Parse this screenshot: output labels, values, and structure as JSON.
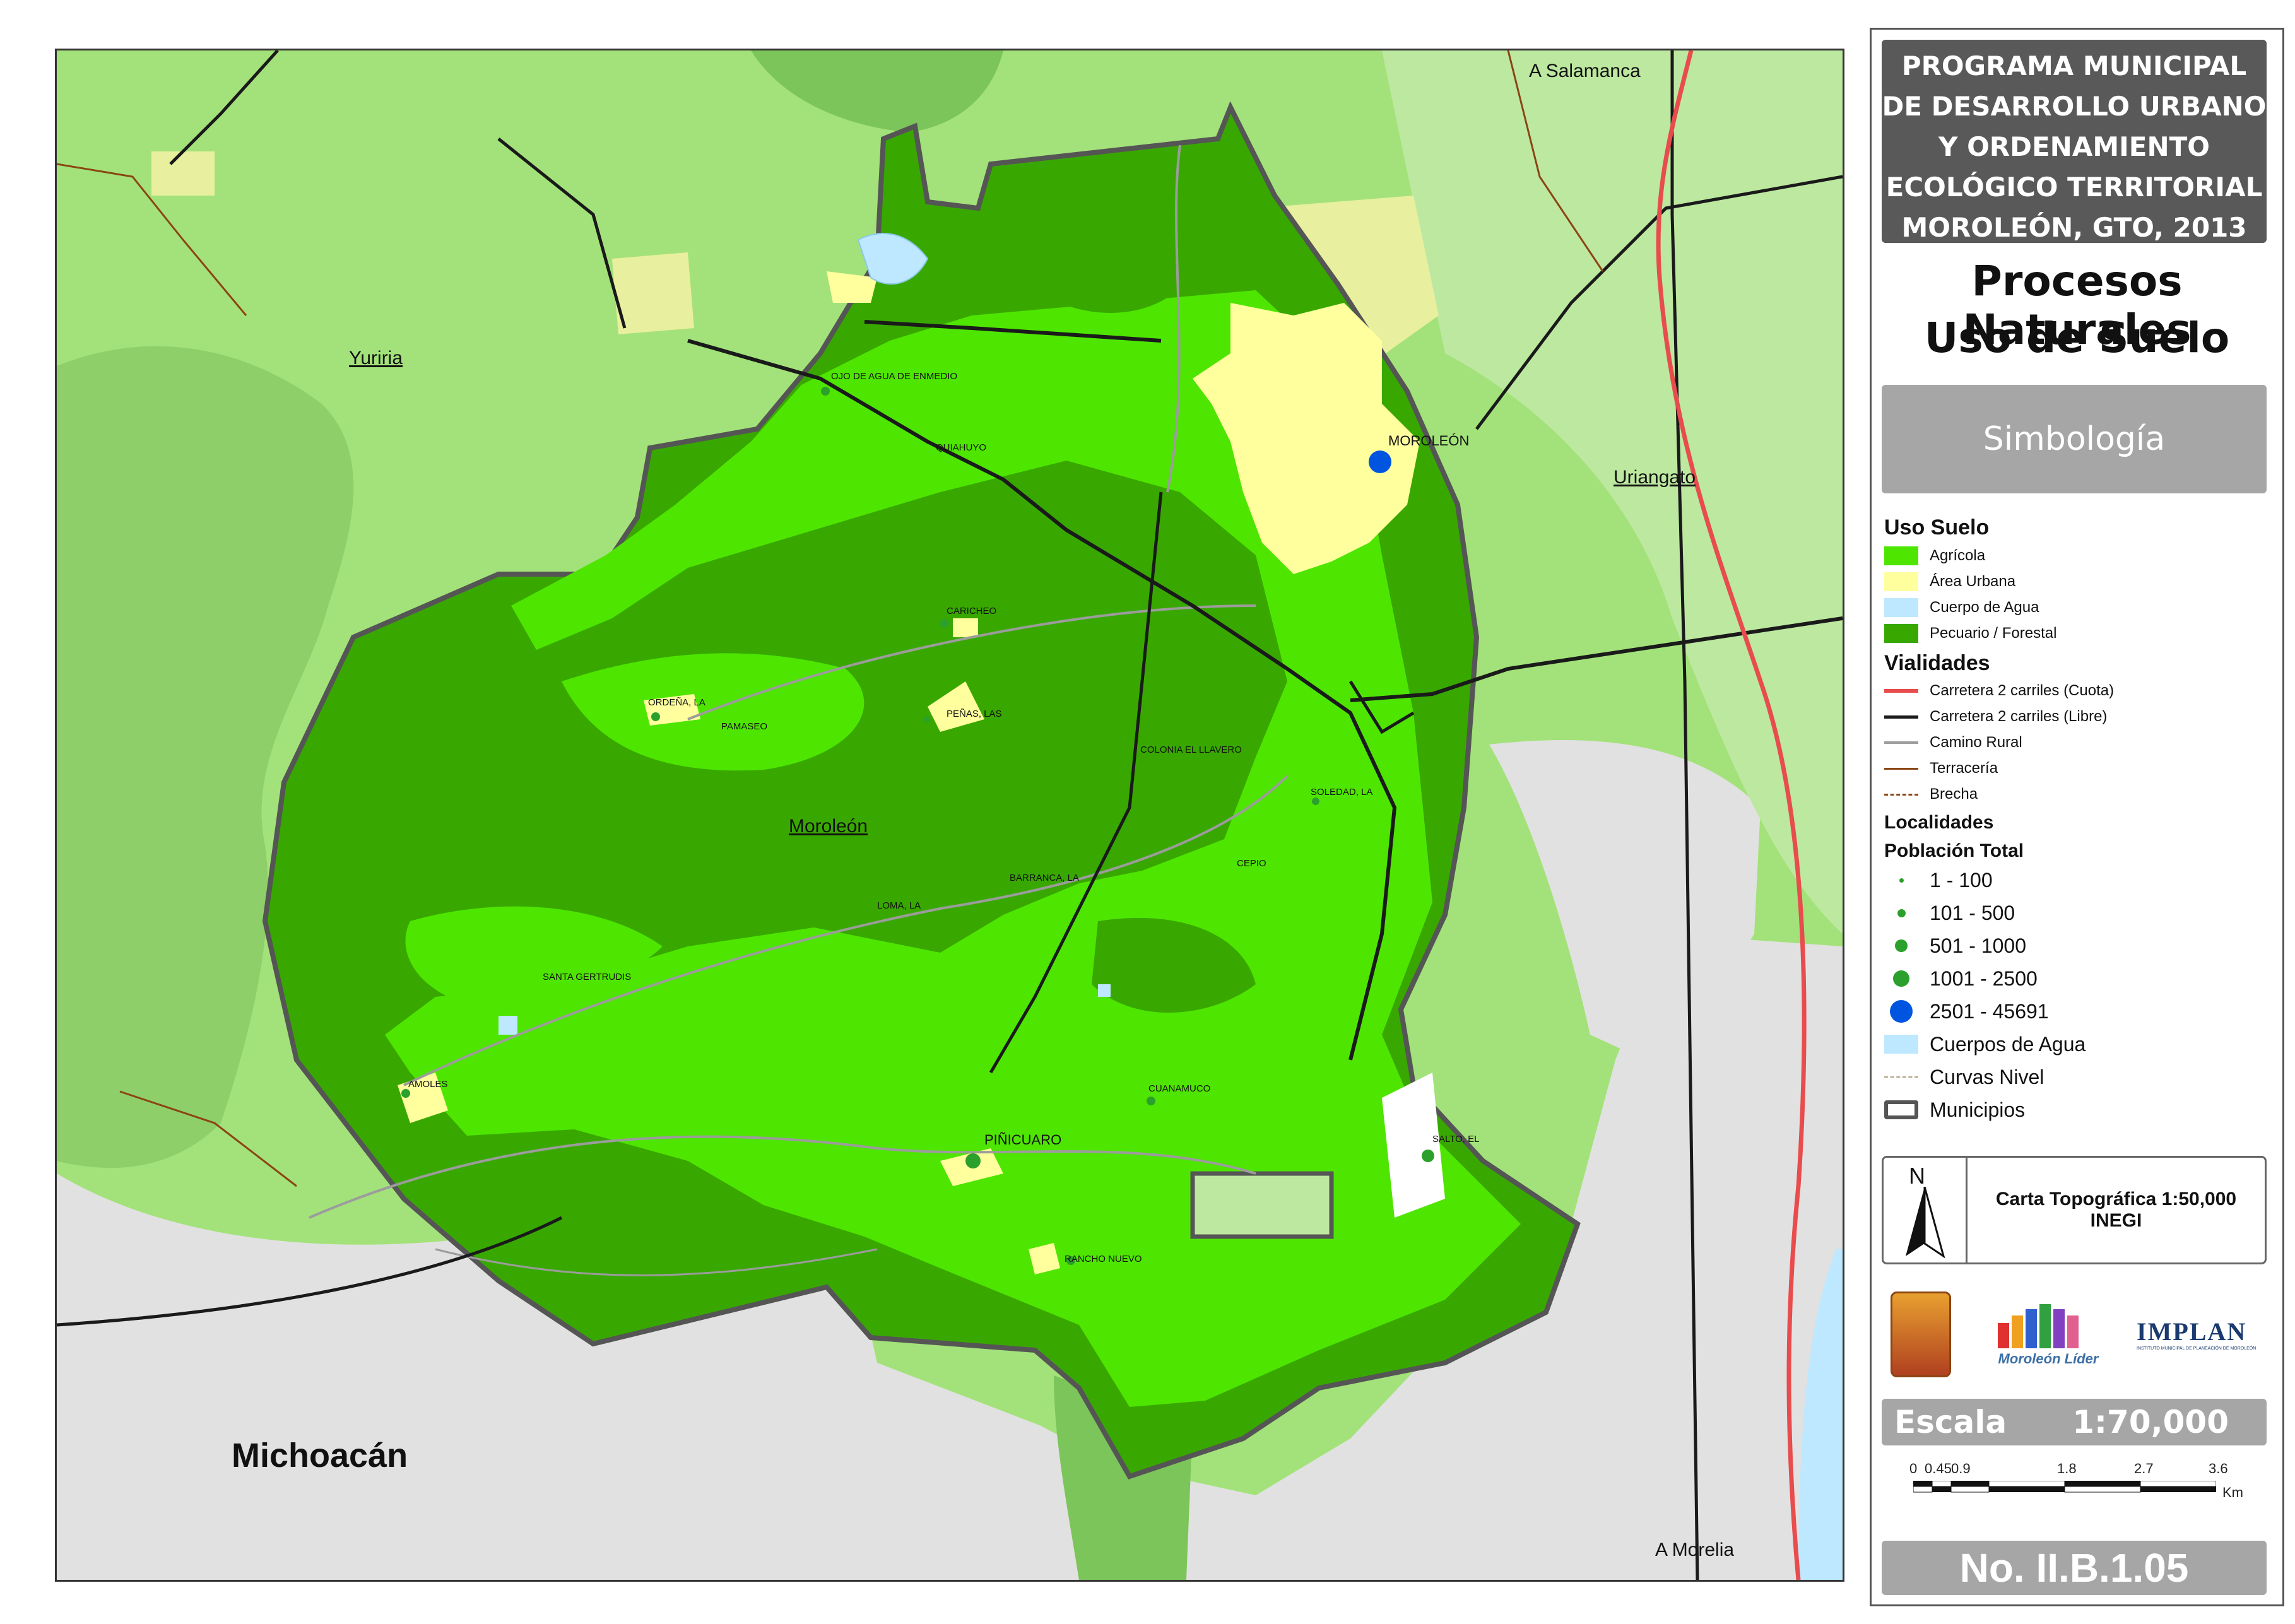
{
  "map": {
    "labels": {
      "yuriria": "Yuriria",
      "uriangato": "Uriangato",
      "moroleon_mun": "Moroleón",
      "michoacan": "Michoacán",
      "a_salamanca": "A Salamanca",
      "a_morelia": "A Morelia"
    },
    "localities": [
      {
        "name": "MOROLEÓN",
        "class": "2501 - 45691"
      },
      {
        "name": "OJO DE AGUA DE ENMEDIO",
        "class": "1 - 100"
      },
      {
        "name": "QUIAHUYO",
        "class": "1 - 100"
      },
      {
        "name": "CARICHEO",
        "class": "101 - 500"
      },
      {
        "name": "ORDEÑA, LA",
        "class": "101 - 500"
      },
      {
        "name": "PAMASEO",
        "class": "1 - 100"
      },
      {
        "name": "PEÑAS, LAS",
        "class": "101 - 500"
      },
      {
        "name": "COLONIA EL LLAVERO",
        "class": "1 - 100"
      },
      {
        "name": "SOLEDAD, LA",
        "class": "101 - 500"
      },
      {
        "name": "CEPIO",
        "class": "1 - 100"
      },
      {
        "name": "BARRANCA, LA",
        "class": "1 - 100"
      },
      {
        "name": "LOMA, LA",
        "class": "1 - 100"
      },
      {
        "name": "SANTA GERTRUDIS",
        "class": "1 - 100"
      },
      {
        "name": "AMOLES",
        "class": "101 - 500"
      },
      {
        "name": "CUANAMUCO",
        "class": "101 - 500"
      },
      {
        "name": "PIÑICUARO",
        "class": "1001 - 2500"
      },
      {
        "name": "SALTO, EL",
        "class": "501 - 1000"
      },
      {
        "name": "RANCHO NUEVO",
        "class": "101 - 500"
      }
    ],
    "colors": {
      "agricola": "#4ee600",
      "urbana": "#ffff9e",
      "agua": "#bee8ff",
      "pecuario": "#38a800",
      "outside_green": "#a3e27a",
      "outside_dark": "#7cc55a",
      "outside_gray": "#e1e1e1",
      "cuota": "#e84c4c",
      "libre": "#1a1a1a",
      "rural": "#9c9c9c",
      "terraceria": "#8b4513",
      "dot_blue": "#0055e0",
      "dot_green": "#2ca02c"
    }
  },
  "panel": {
    "title_lines": [
      "PROGRAMA MUNICIPAL",
      "DE DESARROLLO URBANO",
      "Y ORDENAMIENTO",
      "ECOLÓGICO TERRITORIAL",
      "MOROLEÓN, GTO, 2013"
    ],
    "subtitle1": "Procesos Naturales",
    "subtitle2": "Uso de Suelo",
    "simbologia": "Simbología",
    "uso_suelo": {
      "heading": "Uso Suelo",
      "items": [
        {
          "label": "Agrícola",
          "color": "#4ee600"
        },
        {
          "label": "Área Urbana",
          "color": "#ffff9e"
        },
        {
          "label": "Cuerpo de Agua",
          "color": "#bee8ff"
        },
        {
          "label": "Pecuario / Forestal",
          "color": "#38a800"
        }
      ]
    },
    "vialidades": {
      "heading": "Vialidades",
      "items": [
        {
          "label": "Carretera 2 carriles (Cuota)",
          "color": "#e84c4c",
          "style": "solid"
        },
        {
          "label": "Carretera 2 carriles (Libre)",
          "color": "#1a1a1a",
          "style": "solid"
        },
        {
          "label": "Camino Rural",
          "color": "#9c9c9c",
          "style": "solid"
        },
        {
          "label": "Terracería",
          "color": "#8b4513",
          "style": "solid"
        },
        {
          "label": "Brecha",
          "color": "#8b4513",
          "style": "dashed"
        }
      ]
    },
    "localidades": {
      "heading": "Localidades",
      "subheading": "Población Total",
      "items": [
        {
          "label": "1 - 100"
        },
        {
          "label": "101 - 500"
        },
        {
          "label": "501 - 1000"
        },
        {
          "label": "1001 - 2500"
        },
        {
          "label": "2501 - 45691"
        }
      ]
    },
    "otros": [
      {
        "label": "Cuerpos de Agua"
      },
      {
        "label": "Curvas Nivel"
      },
      {
        "label": "Municipios"
      }
    ],
    "north": "N",
    "carta_line1": "Carta Topográfica 1:50,000",
    "carta_line2": "INEGI",
    "logos": {
      "moroleon_lider": "Moroleón Líder",
      "implan": "IMPLAN",
      "implan_sub": "INSTITUTO MUNICIPAL DE PLANEACIÓN DE MOROLEÓN"
    },
    "escala_label": "Escala",
    "escala_value": "1:70,000",
    "scale_ticks": [
      "0",
      "0.45",
      "0.9",
      "1.8",
      "2.7",
      "3.6"
    ],
    "scale_unit": "Km",
    "plate_number": "No. II.B.1.05"
  }
}
